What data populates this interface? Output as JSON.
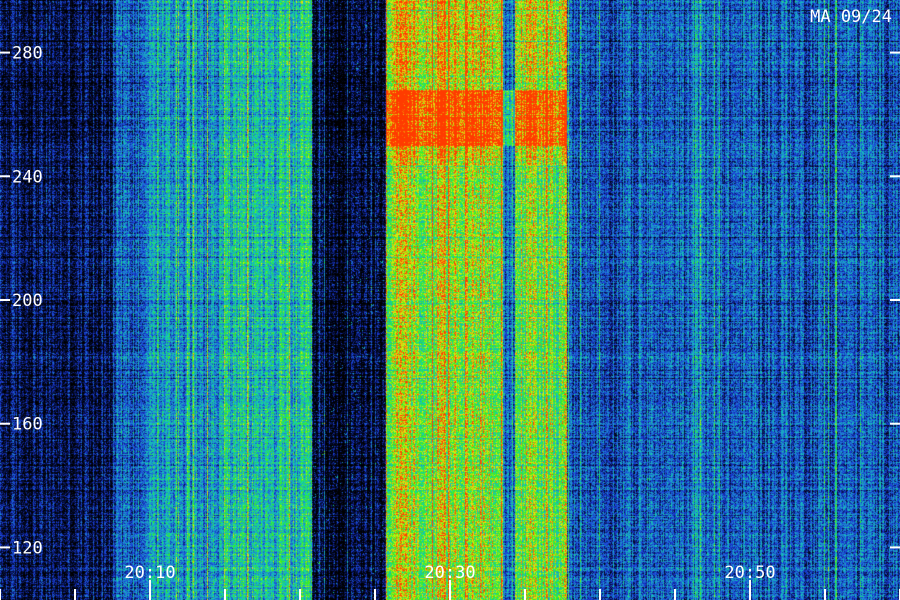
{
  "station_label": "MA 09/24",
  "chart_data": {
    "type": "heatmap",
    "title": "",
    "xlabel": "",
    "ylabel": "",
    "x_tick_labels": [
      "20:10",
      "20:30",
      "20:50"
    ],
    "x_tick_values_min": [
      10,
      30,
      50
    ],
    "x_range_min": [
      0,
      60
    ],
    "y_ticks": [
      120,
      160,
      200,
      240,
      280
    ],
    "y_range": [
      103,
      297
    ],
    "colormap": [
      "#000000",
      "#07134d",
      "#1a3ad9",
      "#1f8ccf",
      "#12d1b4",
      "#35f01a",
      "#e6ee10",
      "#ff3a00"
    ],
    "intensity_bands": [
      {
        "x_from_min": 0.0,
        "x_to_min": 7.5,
        "level": 0.14
      },
      {
        "x_from_min": 7.5,
        "x_to_min": 9.5,
        "level": 0.34
      },
      {
        "x_from_min": 9.5,
        "x_to_min": 15.0,
        "level": 0.46
      },
      {
        "x_from_min": 15.0,
        "x_to_min": 20.8,
        "level": 0.54
      },
      {
        "x_from_min": 20.8,
        "x_to_min": 25.7,
        "level": 0.06
      },
      {
        "x_from_min": 25.7,
        "x_to_min": 33.5,
        "level": 0.78
      },
      {
        "x_from_min": 33.5,
        "x_to_min": 34.3,
        "level": 0.32
      },
      {
        "x_from_min": 34.3,
        "x_to_min": 37.8,
        "level": 0.74
      },
      {
        "x_from_min": 37.8,
        "x_to_min": 46.0,
        "level": 0.32
      },
      {
        "x_from_min": 46.0,
        "x_to_min": 47.0,
        "level": 0.44
      },
      {
        "x_from_min": 47.0,
        "x_to_min": 60.0,
        "level": 0.33
      }
    ],
    "hot_band_freq": [
      250,
      268
    ]
  }
}
